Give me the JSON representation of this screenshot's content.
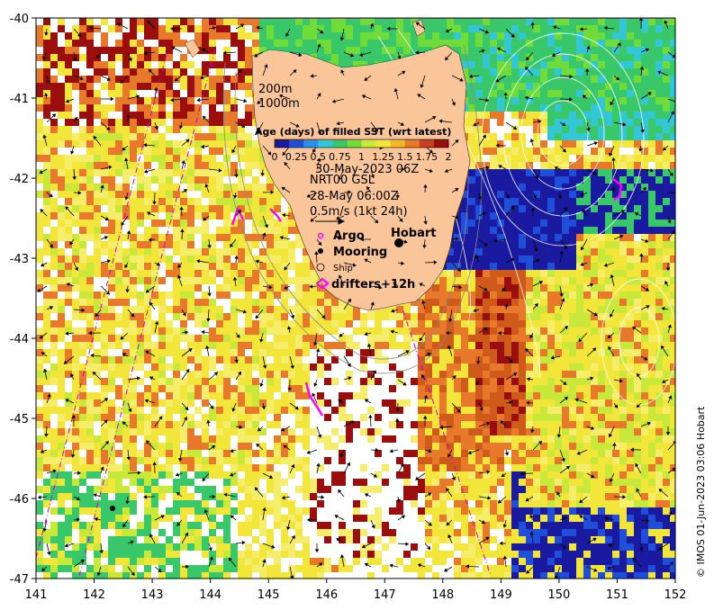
{
  "map": {
    "x_ticks": [
      "141",
      "142",
      "143",
      "144",
      "145",
      "146",
      "147",
      "148",
      "149",
      "150",
      "151",
      "152"
    ],
    "y_ticks": [
      "-40",
      "-41",
      "-42",
      "-43",
      "-44",
      "-45",
      "-46",
      "-47"
    ],
    "x_range": [
      141,
      152
    ],
    "y_range": [
      -47,
      -40
    ]
  },
  "contours": {
    "label_200m": "200m",
    "label_1000m": "1000m"
  },
  "colorbar": {
    "title": "Age (days) of filled SST (wrt latest)",
    "tick_labels": [
      "0",
      "0.25",
      "0.5",
      "0.75",
      "1",
      "1.25",
      "1.5",
      "1.75",
      "2"
    ],
    "colors": [
      "#1a1aa0",
      "#1f4fd8",
      "#2a8fe8",
      "#33c7d6",
      "#38c86a",
      "#6fdc3a",
      "#c8e83a",
      "#f2e63a",
      "#f3b82a",
      "#e8782a",
      "#c8401e",
      "#9a0e0e"
    ]
  },
  "info": {
    "date": "30-May-2023 06Z",
    "product": "NRT00 GSL",
    "current_time": "28-May 06:00Z",
    "scale_label": "0.5m/s (1kt 24h)"
  },
  "legend": {
    "argo": "Argo",
    "mooring": "Mooring",
    "ship": "Ship",
    "drifters": "drifters+12h"
  },
  "places": {
    "hobart": "Hobart"
  },
  "credit": "© IMOS 01-Jun-2023 03:06 Hobart",
  "colors": {
    "land": "#fbc59a",
    "argo": "#ff00ff",
    "drifters": "#ff00ff",
    "ship_track": "#cc00cc"
  }
}
